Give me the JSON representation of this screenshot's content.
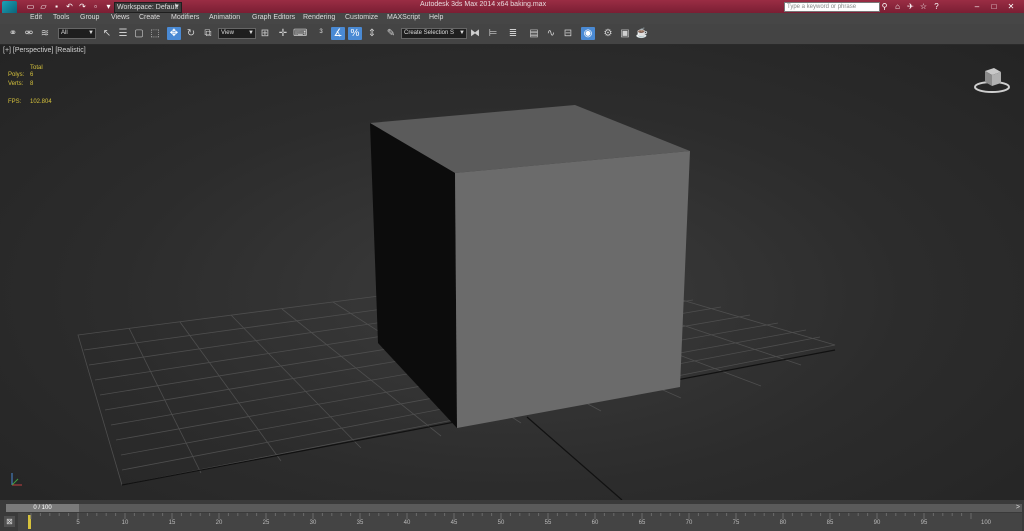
{
  "app": {
    "title": "Autodesk 3ds Max 2014 x64    baking.max",
    "search_placeholder": "Type a keyword or phrase",
    "workspace": "Workspace: Default"
  },
  "menu": [
    "Edit",
    "Tools",
    "Group",
    "Views",
    "Create",
    "Modifiers",
    "Animation",
    "Graph Editors",
    "Rendering",
    "Customize",
    "MAXScript",
    "Help"
  ],
  "toolbar": {
    "filter": "All",
    "ref_coord": "View",
    "named_selection": "Create Selection S"
  },
  "viewport": {
    "label": "[+] [Perspective] [Realistic]",
    "stats": {
      "total_label": "Total",
      "polys_label": "Polys:",
      "polys_value": "6",
      "verts_label": "Verts:",
      "verts_value": "8",
      "fps_label": "FPS:",
      "fps_value": "102.804"
    }
  },
  "timeline": {
    "current": "0 / 100",
    "ticks": [
      "5",
      "10",
      "15",
      "20",
      "25",
      "30",
      "35",
      "40",
      "45",
      "50",
      "55",
      "60",
      "65",
      "70",
      "75",
      "80",
      "85",
      "90",
      "95",
      "100"
    ]
  },
  "colors": {
    "titlebar": "#8a2a3f",
    "accent": "#4a8ad4",
    "stats_text": "#d6c23c",
    "grid": "#555555",
    "cube_front": "#6b6b6b",
    "cube_top": "#5b5b5b",
    "cube_side": "#0c0c0c"
  }
}
